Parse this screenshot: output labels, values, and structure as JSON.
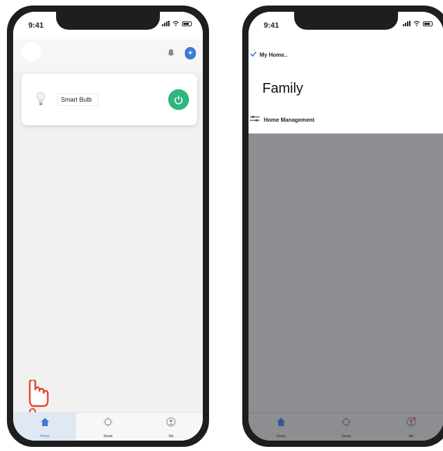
{
  "left_phone": {
    "status_time": "9:41",
    "device": {
      "name": "Smart Bulb"
    },
    "tabs": [
      {
        "label": "Home",
        "icon": "home-icon"
      },
      {
        "label": "Smart",
        "icon": "smart-icon"
      },
      {
        "label": "Me",
        "icon": "profile-icon"
      }
    ]
  },
  "right_phone": {
    "status_time": "9:41",
    "menu": {
      "current_home": "My Home..",
      "family": "Family",
      "management": "Home Management"
    },
    "tabs": [
      {
        "label": "Home",
        "icon": "home-icon"
      },
      {
        "label": "Smart",
        "icon": "smart-icon"
      },
      {
        "label": "Me",
        "icon": "profile-icon"
      }
    ]
  },
  "colors": {
    "accent": "#3a7bd5",
    "power": "#2eb67d",
    "hand": "#e0452e",
    "overlay": "#8d8e92"
  }
}
